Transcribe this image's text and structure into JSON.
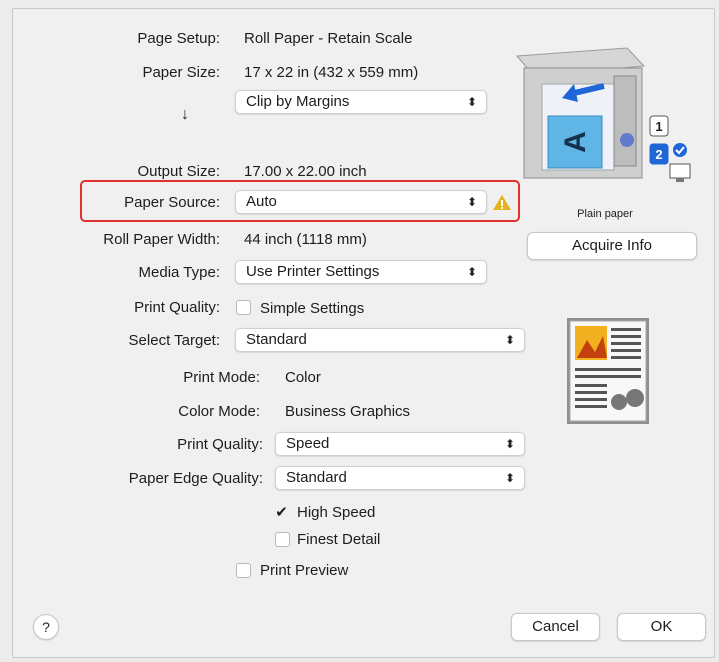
{
  "form": {
    "page_setup": {
      "label": "Page Setup:",
      "value": "Roll Paper - Retain Scale"
    },
    "paper_size": {
      "label": "Paper Size:",
      "value": "17 x 22 in (432 x 559 mm)"
    },
    "clip": {
      "value": "Clip by Margins"
    },
    "arrow": "↓",
    "output_size": {
      "label": "Output Size:",
      "value": "17.00 x 22.00 inch"
    },
    "paper_source": {
      "label": "Paper Source:",
      "value": "Auto"
    },
    "roll_paper_width": {
      "label": "Roll Paper Width:",
      "value": "44 inch (1118 mm)"
    },
    "media_type": {
      "label": "Media Type:",
      "value": "Use Printer Settings"
    },
    "print_quality_top": {
      "label": "Print Quality:",
      "checkbox_label": "Simple Settings",
      "checked": false
    },
    "select_target": {
      "label": "Select Target:",
      "value": "Standard"
    },
    "print_mode": {
      "label": "Print Mode:",
      "value": "Color"
    },
    "color_mode": {
      "label": "Color Mode:",
      "value": "Business Graphics"
    },
    "print_quality": {
      "label": "Print Quality:",
      "value": "Speed"
    },
    "paper_edge_quality": {
      "label": "Paper Edge Quality:",
      "value": "Standard"
    },
    "high_speed": {
      "label": "High Speed",
      "checked": true
    },
    "finest_detail": {
      "label": "Finest Detail",
      "checked": false
    },
    "print_preview": {
      "label": "Print Preview",
      "checked": false
    }
  },
  "side": {
    "paper_type": "Plain paper",
    "acquire_button": "Acquire Info",
    "printer_tray_numbers": [
      "1",
      "2"
    ],
    "sheet_letter": "A"
  },
  "footer": {
    "help": "?",
    "cancel": "Cancel",
    "ok": "OK"
  },
  "icons": {
    "chevron": "updown-chevron-icon",
    "warning": "warning-icon",
    "check": "checkmark-icon"
  },
  "colors": {
    "highlight": "#e2312f",
    "warning": "#e3b21f",
    "accent_blue": "#1f66d6"
  }
}
